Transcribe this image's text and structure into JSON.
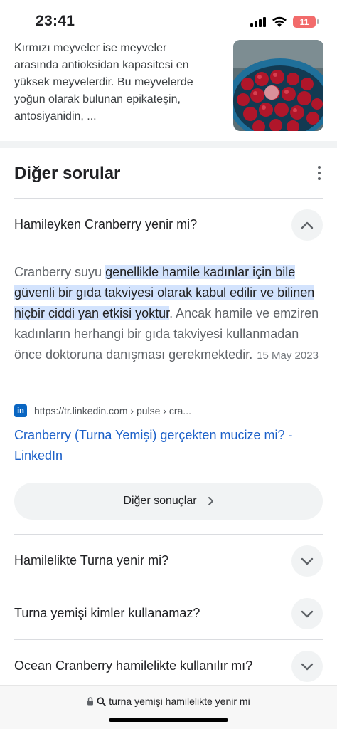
{
  "status_bar": {
    "time": "23:41",
    "battery_level": "11",
    "icons": [
      "cellular-signal-icon",
      "wifi-icon",
      "battery-icon"
    ],
    "battery_color": "#f26b6b"
  },
  "snippet": {
    "text": "Kırmızı meyveler ise meyveler arasında antioksidan kapasitesi en yüksek meyvelerdir. Bu meyvelerde yoğun olarak bulunan epikateşin, antosiyanidin, ..."
  },
  "other_questions": {
    "title": "Diğer sorular",
    "expanded": {
      "question": "Hamileyken Cranberry yenir mi?",
      "answer_pre": "Cranberry suyu ",
      "answer_highlight": "genellikle hamile kadınlar için bile güvenli bir gıda takviyesi olarak kabul edilir ve bilinen hiçbir ciddi yan etkisi yoktur",
      "answer_post": ". Ancak hamile ve emziren kadınların herhangi bir gıda takviyesi kullanmadan önce doktoruna danışması gerekmektedir.",
      "date": "15 May 2023",
      "source_icon": "linkedin-icon",
      "source_url": "https://tr.linkedin.com › pulse › cra...",
      "source_title": "Cranberry (Turna Yemişi) gerçekten mucize mi? - LinkedIn",
      "more_results_label": "Diğer sonuçlar"
    },
    "questions": [
      "Hamilelikte Turna yenir mi?",
      "Turna yemişi kimler kullanamaz?",
      "Ocean Cranberry hamilelikte kullanılır mı?"
    ]
  },
  "address_bar": {
    "query": "turna yemişi hamilelikte yenir mi"
  },
  "colors": {
    "highlight": "#d3e3fd",
    "link": "#1a5fc8",
    "chip_bg": "#f1f3f4"
  }
}
